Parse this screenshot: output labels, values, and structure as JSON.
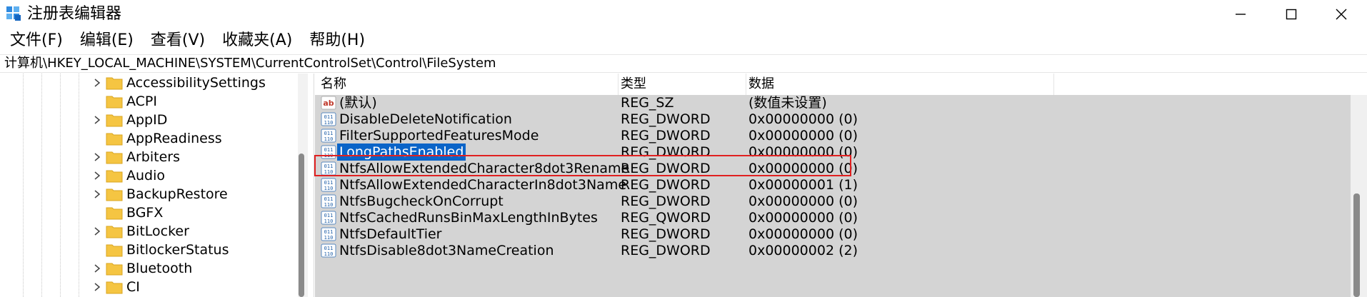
{
  "window": {
    "title": "注册表编辑器",
    "icon": "regedit-icon",
    "controls": {
      "minimize": "minimize-icon",
      "maximize": "maximize-icon",
      "close": "close-icon"
    }
  },
  "menu": [
    "文件(F)",
    "编辑(E)",
    "查看(V)",
    "收藏夹(A)",
    "帮助(H)"
  ],
  "address": "计算机\\HKEY_LOCAL_MACHINE\\SYSTEM\\CurrentControlSet\\Control\\FileSystem",
  "tree": {
    "items": [
      {
        "label": "AccessibilitySettings",
        "expandable": true
      },
      {
        "label": "ACPI",
        "expandable": false
      },
      {
        "label": "AppID",
        "expandable": true
      },
      {
        "label": "AppReadiness",
        "expandable": false
      },
      {
        "label": "Arbiters",
        "expandable": true
      },
      {
        "label": "Audio",
        "expandable": true
      },
      {
        "label": "BackupRestore",
        "expandable": true
      },
      {
        "label": "BGFX",
        "expandable": false
      },
      {
        "label": "BitLocker",
        "expandable": true
      },
      {
        "label": "BitlockerStatus",
        "expandable": false
      },
      {
        "label": "Bluetooth",
        "expandable": true
      },
      {
        "label": "CI",
        "expandable": true
      }
    ]
  },
  "list": {
    "columns": {
      "name": "名称",
      "type": "类型",
      "data": "数据"
    },
    "rows": [
      {
        "icon": "string-value-icon",
        "name": "(默认)",
        "type": "REG_SZ",
        "data": "(数值未设置)",
        "selected": false
      },
      {
        "icon": "binary-value-icon",
        "name": "DisableDeleteNotification",
        "type": "REG_DWORD",
        "data": "0x00000000 (0)",
        "selected": false
      },
      {
        "icon": "binary-value-icon",
        "name": "FilterSupportedFeaturesMode",
        "type": "REG_DWORD",
        "data": "0x00000000 (0)",
        "selected": false
      },
      {
        "icon": "binary-value-icon",
        "name": "LongPathsEnabled",
        "type": "REG_DWORD",
        "data": "0x00000000 (0)",
        "selected": true
      },
      {
        "icon": "binary-value-icon",
        "name": "NtfsAllowExtendedCharacter8dot3Rename",
        "type": "REG_DWORD",
        "data": "0x00000000 (0)",
        "selected": false
      },
      {
        "icon": "binary-value-icon",
        "name": "NtfsAllowExtendedCharacterIn8dot3Name",
        "type": "REG_DWORD",
        "data": "0x00000001 (1)",
        "selected": false
      },
      {
        "icon": "binary-value-icon",
        "name": "NtfsBugcheckOnCorrupt",
        "type": "REG_DWORD",
        "data": "0x00000000 (0)",
        "selected": false
      },
      {
        "icon": "binary-value-icon",
        "name": "NtfsCachedRunsBinMaxLengthInBytes",
        "type": "REG_QWORD",
        "data": "0x00000000 (0)",
        "selected": false
      },
      {
        "icon": "binary-value-icon",
        "name": "NtfsDefaultTier",
        "type": "REG_DWORD",
        "data": "0x00000000 (0)",
        "selected": false
      },
      {
        "icon": "binary-value-icon",
        "name": "NtfsDisable8dot3NameCreation",
        "type": "REG_DWORD",
        "data": "0x00000002 (2)",
        "selected": false
      }
    ]
  },
  "colors": {
    "selection": "#0a64c8",
    "highlight_border": "#e02020",
    "list_background": "#d4d4d4",
    "folder": "#f5c542"
  }
}
